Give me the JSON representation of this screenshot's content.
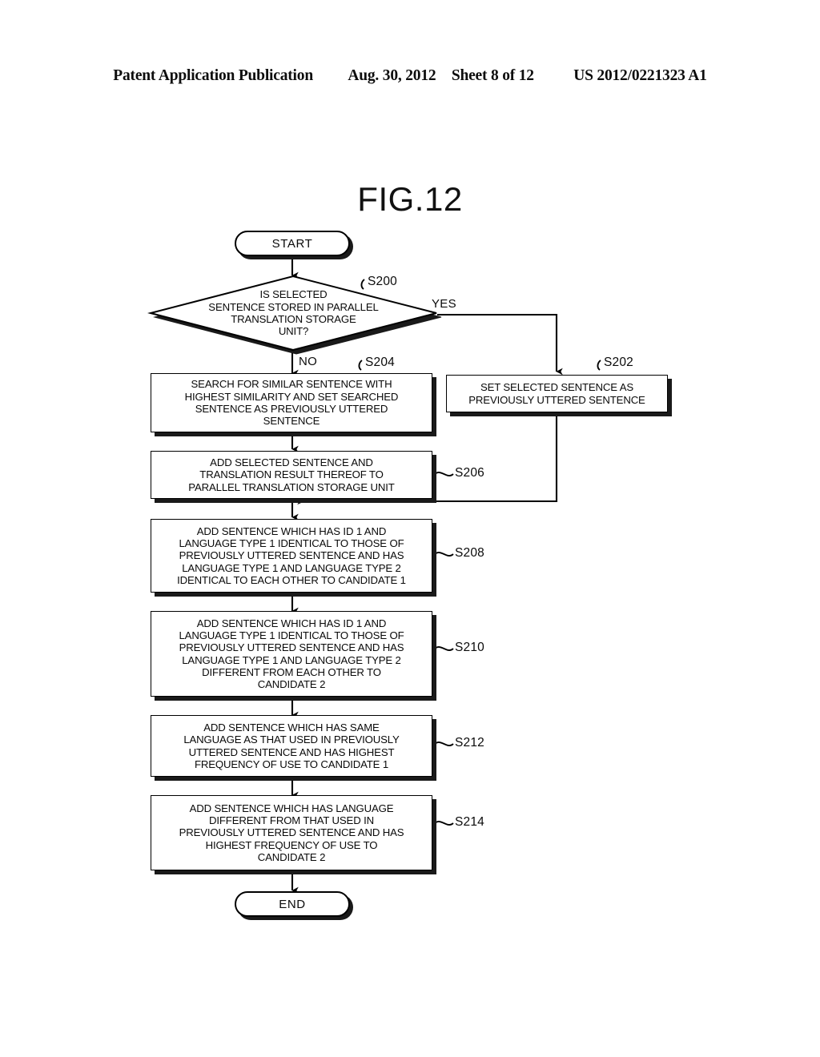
{
  "header": {
    "publication": "Patent Application Publication",
    "date": "Aug. 30, 2012",
    "sheet": "Sheet 8 of 12",
    "doc_number": "US 2012/0221323 A1"
  },
  "figure": {
    "title": "FIG.12"
  },
  "flow": {
    "start": {
      "label": "START",
      "shape": "terminator"
    },
    "end": {
      "label": "END",
      "shape": "terminator"
    },
    "decision": {
      "step": "S200",
      "text": "IS SELECTED\nSENTENCE STORED IN PARALLEL\nTRANSLATION STORAGE\nUNIT?",
      "yes_label": "YES",
      "no_label": "NO"
    },
    "steps": [
      {
        "step": "S202",
        "text": "SET SELECTED SENTENCE AS\nPREVIOUSLY UTTERED SENTENCE"
      },
      {
        "step": "S204",
        "text": "SEARCH FOR SIMILAR SENTENCE WITH\nHIGHEST SIMILARITY AND SET SEARCHED\nSENTENCE AS PREVIOUSLY UTTERED\nSENTENCE"
      },
      {
        "step": "S206",
        "text": "ADD SELECTED SENTENCE AND\nTRANSLATION RESULT THEREOF TO\nPARALLEL TRANSLATION STORAGE UNIT"
      },
      {
        "step": "S208",
        "text": "ADD SENTENCE WHICH HAS ID 1 AND\nLANGUAGE TYPE 1 IDENTICAL TO THOSE OF\nPREVIOUSLY UTTERED SENTENCE AND HAS\nLANGUAGE TYPE 1 AND LANGUAGE TYPE 2\nIDENTICAL TO EACH OTHER TO CANDIDATE 1"
      },
      {
        "step": "S210",
        "text": "ADD SENTENCE WHICH HAS ID 1 AND\nLANGUAGE TYPE 1 IDENTICAL TO THOSE OF\nPREVIOUSLY UTTERED SENTENCE AND HAS\nLANGUAGE TYPE 1 AND LANGUAGE TYPE 2\nDIFFERENT FROM EACH OTHER TO\nCANDIDATE 2"
      },
      {
        "step": "S212",
        "text": "ADD SENTENCE WHICH HAS SAME\nLANGUAGE AS THAT USED IN PREVIOUSLY\nUTTERED SENTENCE AND HAS HIGHEST\nFREQUENCY OF USE TO CANDIDATE 1"
      },
      {
        "step": "S214",
        "text": "ADD SENTENCE WHICH HAS LANGUAGE\nDIFFERENT FROM THAT USED IN\nPREVIOUSLY UTTERED SENTENCE AND HAS\nHIGHEST FREQUENCY OF USE TO\nCANDIDATE 2"
      }
    ]
  },
  "colors": {
    "ink": "#000000",
    "paper": "#ffffff",
    "shadow": "#1a1a1a"
  }
}
